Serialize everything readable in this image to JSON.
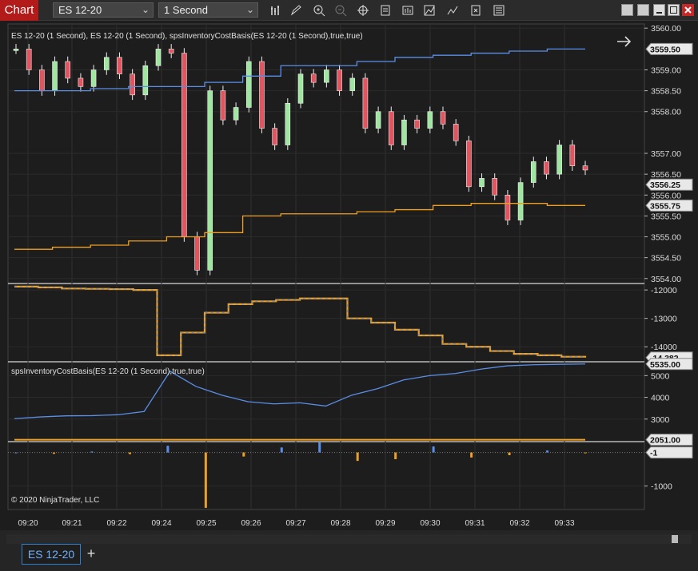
{
  "window": {
    "tab_label": "Chart",
    "add_tab": "+"
  },
  "toolbar": {
    "instrument": "ES 12-20",
    "interval": "1 Second"
  },
  "panels": {
    "price_title": "ES 12-20 (1 Second), ES 12-20 (1 Second), spsInventoryCostBasis(ES 12-20 (1 Second),true,true)",
    "inventory_title": "spsInventoryCostBasis(ES 12-20 (1 Second),true,true)",
    "copyright": "© 2020 NinjaTrader, LLC"
  },
  "axis": {
    "price_ticks": [
      "3560.00",
      "3559.00",
      "3558.50",
      "3558.00",
      "3557.00",
      "3556.50",
      "3556.00",
      "3555.50",
      "3555.00",
      "3554.50",
      "3554.00"
    ],
    "price_flags": [
      "3559.50",
      "3556.25",
      "3555.75"
    ],
    "p2_ticks": [
      "-12000",
      "-13000",
      "-14000"
    ],
    "p2_flag": "-14,382",
    "p3_ticks": [
      "5000",
      "4000",
      "3000"
    ],
    "p3_flags": [
      "5535.00",
      "2051.00"
    ],
    "p4_ticks": [
      "-1000"
    ],
    "p4_flag": "-1",
    "time_ticks": [
      "09:20",
      "09:21",
      "09:22",
      "09:24",
      "09:25",
      "09:26",
      "09:27",
      "09:28",
      "09:29",
      "09:30",
      "09:31",
      "09:32",
      "09:33"
    ]
  },
  "colors": {
    "blue": "#5b8ee6",
    "orange": "#f0a020",
    "up": "#9fe6a0",
    "down": "#e05560",
    "flag_bg": "#e8e8e8"
  },
  "chart_data": [
    {
      "type": "candlestick",
      "title": "ES 12-20 (1 Second)",
      "x": [
        "09:20",
        "09:33"
      ],
      "ylim": [
        3553.9,
        3560.1
      ],
      "series": [
        {
          "name": "ES 12-20 (1 Second)",
          "values": [
            3559.5,
            3559.0,
            3558.5,
            3559.2,
            3558.8,
            3558.6,
            3559.0,
            3559.3,
            3558.9,
            3558.4,
            3559.1,
            3559.5,
            3559.4,
            3555.0,
            3554.2,
            3558.5,
            3557.8,
            3558.1,
            3559.2,
            3557.6,
            3557.2,
            3558.2,
            3558.9,
            3558.7,
            3559.0,
            3558.5,
            3558.8,
            3557.6,
            3558.0,
            3557.2,
            3557.8,
            3557.6,
            3558.0,
            3557.7,
            3557.3,
            3556.2,
            3556.4,
            3556.0,
            3555.4,
            3556.3,
            3556.8,
            3556.5,
            3557.2,
            3556.7,
            3556.6
          ]
        },
        {
          "name": "spsInventoryCostBasis",
          "values": [
            3558.5,
            3558.5,
            3558.55,
            3558.6,
            3558.6,
            3558.7,
            3558.85,
            3559.1,
            3559.1,
            3559.2,
            3559.3,
            3559.35,
            3559.4,
            3559.45,
            3559.5,
            3559.5
          ]
        },
        {
          "name": "spsInventoryCostBasis lower",
          "values": [
            3554.7,
            3554.75,
            3554.8,
            3554.9,
            3555.0,
            3555.1,
            3555.5,
            3555.55,
            3555.55,
            3555.6,
            3555.65,
            3555.75,
            3555.8,
            3555.8,
            3555.75,
            3555.75
          ]
        }
      ]
    },
    {
      "type": "line",
      "ylim": [
        -14500,
        -11800
      ],
      "series": [
        {
          "name": "panel2",
          "values": [
            -11880,
            -11910,
            -11950,
            -11960,
            -11970,
            -12000,
            -14300,
            -13500,
            -12800,
            -12500,
            -12400,
            -12350,
            -12300,
            -12300,
            -13000,
            -13150,
            -13400,
            -13600,
            -13900,
            -14000,
            -14150,
            -14250,
            -14300,
            -14350,
            -14382
          ]
        }
      ]
    },
    {
      "type": "line",
      "ylim": [
        2000,
        5600
      ],
      "series": [
        {
          "name": "spsInventoryCostBasis",
          "values": [
            3020,
            3100,
            3150,
            3160,
            3200,
            3350,
            5200,
            4500,
            4100,
            3800,
            3700,
            3750,
            3600,
            4100,
            4400,
            4800,
            5000,
            5100,
            5300,
            5450,
            5500,
            5520,
            5535
          ]
        },
        {
          "name": "lower",
          "values": [
            2051,
            2051,
            2051
          ]
        }
      ]
    },
    {
      "type": "bar",
      "ylim": [
        -1700,
        300
      ],
      "series": [
        {
          "name": "panel4",
          "values": [
            0,
            -40,
            30,
            -50,
            200,
            -1650,
            -120,
            150,
            300,
            -250,
            -200,
            180,
            -150,
            -80,
            60,
            -1
          ]
        }
      ]
    }
  ]
}
